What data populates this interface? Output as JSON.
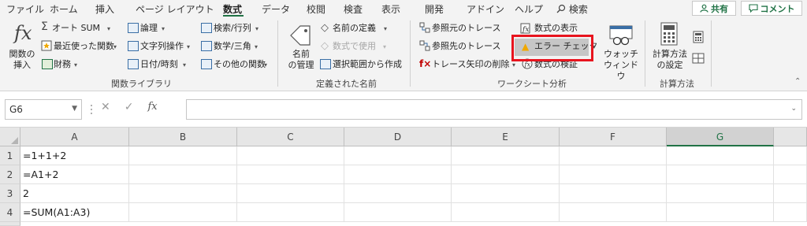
{
  "tabs": [
    {
      "label": "ファイル",
      "active": false
    },
    {
      "label": "ホーム",
      "active": false
    },
    {
      "label": "挿入",
      "active": false
    },
    {
      "label": "ページ レイアウト",
      "active": false
    },
    {
      "label": "数式",
      "active": true
    },
    {
      "label": "データ",
      "active": false
    },
    {
      "label": "校閲",
      "active": false
    },
    {
      "label": "検査",
      "active": false
    },
    {
      "label": "表示",
      "active": false
    },
    {
      "label": "開発",
      "active": false
    },
    {
      "label": "アドイン",
      "active": false
    },
    {
      "label": "ヘルプ",
      "active": false
    }
  ],
  "search_label": "検索",
  "share_label": "共有",
  "comment_label": "コメント",
  "ribbon": {
    "function_library": {
      "insert_function_1": "関数の",
      "insert_function_2": "挿入",
      "autosum": "オート SUM",
      "recent": "最近使った関数",
      "financial": "財務",
      "logical": "論理",
      "text": "文字列操作",
      "datetime": "日付/時刻",
      "lookup": "検索/行列",
      "math": "数学/三角",
      "more": "その他の関数",
      "label": "関数ライブラリ"
    },
    "defined_names": {
      "name_manager_1": "名前",
      "name_manager_2": "の管理",
      "define_name": "名前の定義",
      "use_in_formula": "数式で使用",
      "create_from_selection": "選択範囲から作成",
      "label": "定義された名前"
    },
    "formula_auditing": {
      "trace_precedents": "参照元のトレース",
      "trace_dependents": "参照先のトレース",
      "remove_arrows": "トレース矢印の削除",
      "show_formulas": "数式の表示",
      "error_checking": "エラー チェック",
      "evaluate_formula": "数式の検証",
      "watch_window_1": "ウォッチ",
      "watch_window_2": "ウィンドウ",
      "label": "ワークシート分析"
    },
    "calculation": {
      "options_1": "計算方法",
      "options_2": "の設定",
      "label": "計算方法"
    }
  },
  "formula_bar": {
    "name_box": "G6",
    "content": ""
  },
  "columns": [
    "A",
    "B",
    "C",
    "D",
    "E",
    "F",
    "G"
  ],
  "selected_column": "G",
  "rows": [
    {
      "num": "1",
      "a": "=1+1+2"
    },
    {
      "num": "2",
      "a": "=A1+2"
    },
    {
      "num": "3",
      "a": "2"
    },
    {
      "num": "4",
      "a": "=SUM(A1:A3)"
    }
  ],
  "colors": {
    "accent": "#217346",
    "highlight_box": "#e8141e"
  }
}
